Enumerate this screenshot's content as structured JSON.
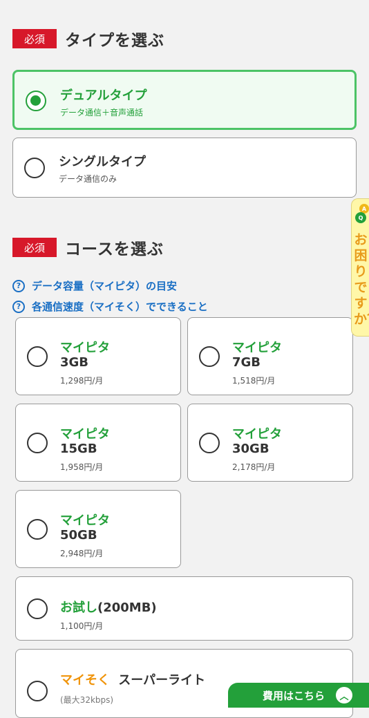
{
  "type_section": {
    "badge": "必須",
    "title": "タイプを選ぶ",
    "options": [
      {
        "title": "デュアルタイプ",
        "sub": "データ通信＋音声通話",
        "selected": true
      },
      {
        "title": "シングルタイプ",
        "sub": "データ通信のみ",
        "selected": false
      }
    ]
  },
  "course_section": {
    "badge": "必須",
    "title": "コースを選ぶ",
    "links": [
      {
        "icon": "?",
        "label": "データ容量（マイピタ）の目安"
      },
      {
        "icon": "?",
        "label": "各通信速度（マイそく）でできること"
      }
    ],
    "plans": [
      {
        "name": "マイピタ",
        "size": "3GB",
        "price": "1,298円/月"
      },
      {
        "name": "マイピタ",
        "size": "7GB",
        "price": "1,518円/月"
      },
      {
        "name": "マイピタ",
        "size": "15GB",
        "price": "1,958円/月"
      },
      {
        "name": "マイピタ",
        "size": "30GB",
        "price": "2,178円/月"
      },
      {
        "name": "マイピタ",
        "size": "50GB",
        "price": "2,948円/月"
      }
    ],
    "trial": {
      "name": "お試し",
      "size": "(200MB)",
      "price": "1,100円/月"
    },
    "maisoku": {
      "name": "マイそく",
      "plan": "スーパーライト",
      "note": "(最大32kbps)"
    }
  },
  "side_tab": {
    "label": "お困りですか？",
    "icon_letters": [
      "A",
      "Q"
    ]
  },
  "cost_bar": {
    "label": "費用はこちら",
    "icon": "︿"
  },
  "colors": {
    "accent_green": "#23a03a",
    "required_red": "#d7182a",
    "link_blue": "#1a6fc4",
    "maisoku_orange": "#f0940a"
  }
}
